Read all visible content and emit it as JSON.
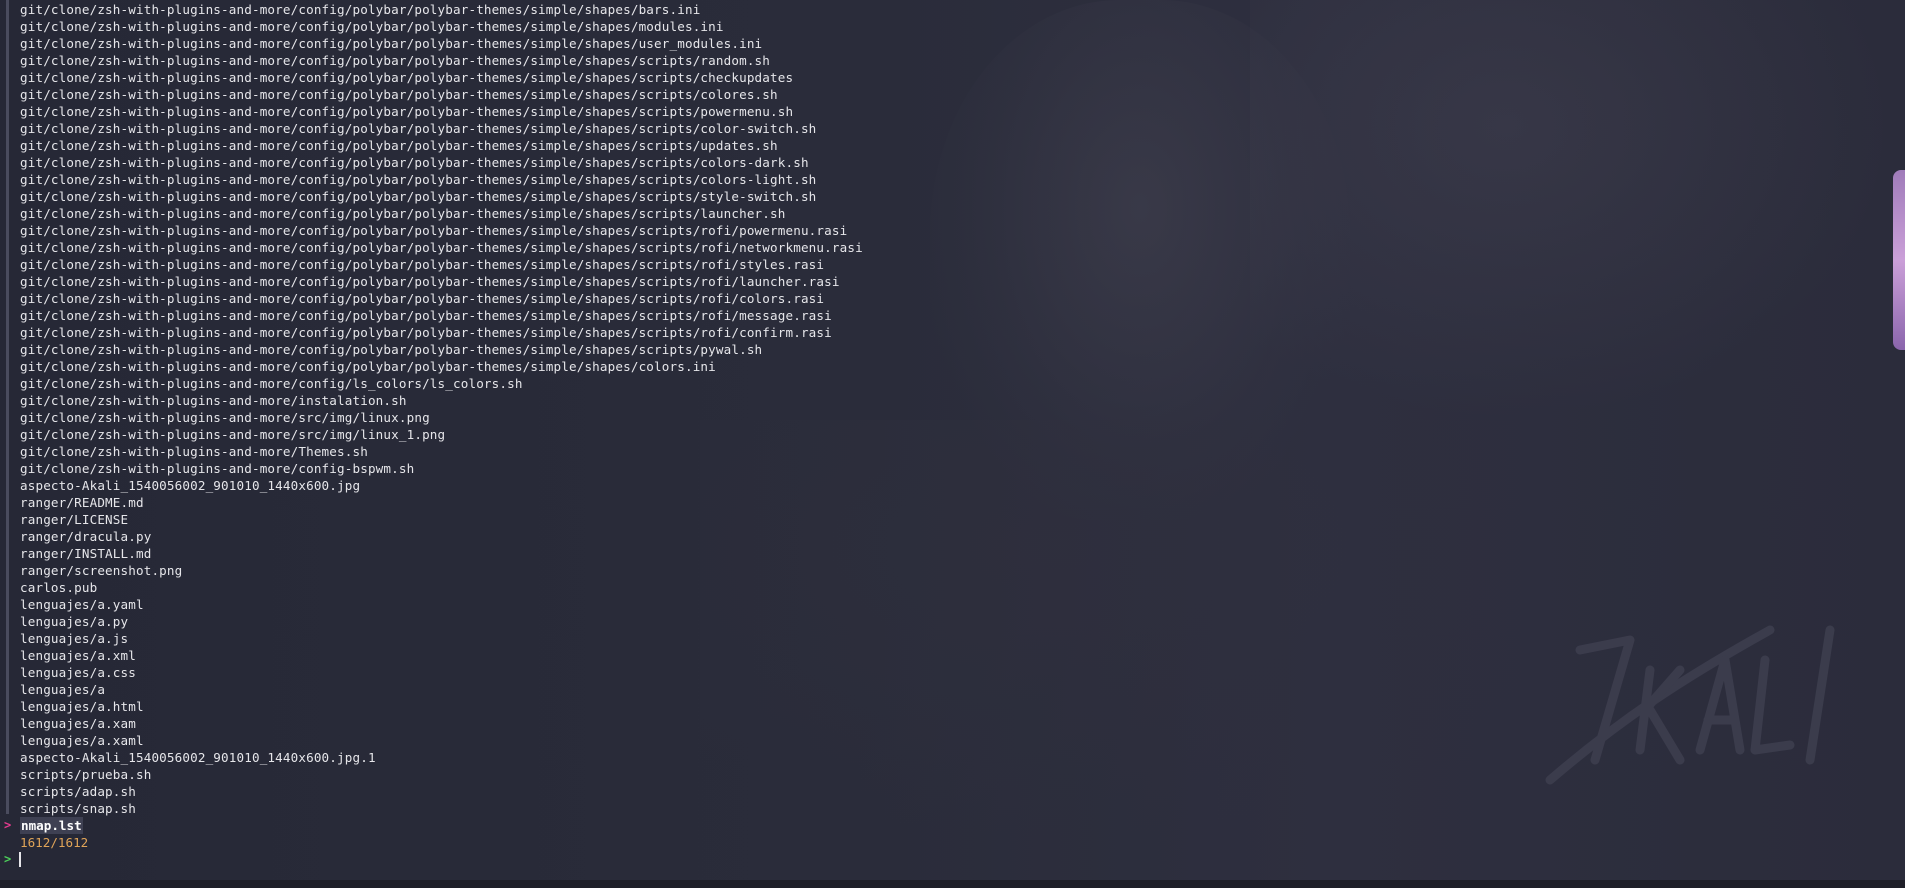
{
  "window": {
    "type": "terminal",
    "tool": "fzf file finder"
  },
  "colors": {
    "background": "#2a2c3a",
    "text": "#e6e6ea",
    "selection_marker": "#e63b8f",
    "prompt_marker": "#4ccf5a",
    "counter": "#e0a458"
  },
  "results": [
    "git/clone/zsh-with-plugins-and-more/config/polybar/polybar-themes/simple/shapes/bars.ini",
    "git/clone/zsh-with-plugins-and-more/config/polybar/polybar-themes/simple/shapes/modules.ini",
    "git/clone/zsh-with-plugins-and-more/config/polybar/polybar-themes/simple/shapes/user_modules.ini",
    "git/clone/zsh-with-plugins-and-more/config/polybar/polybar-themes/simple/shapes/scripts/random.sh",
    "git/clone/zsh-with-plugins-and-more/config/polybar/polybar-themes/simple/shapes/scripts/checkupdates",
    "git/clone/zsh-with-plugins-and-more/config/polybar/polybar-themes/simple/shapes/scripts/colores.sh",
    "git/clone/zsh-with-plugins-and-more/config/polybar/polybar-themes/simple/shapes/scripts/powermenu.sh",
    "git/clone/zsh-with-plugins-and-more/config/polybar/polybar-themes/simple/shapes/scripts/color-switch.sh",
    "git/clone/zsh-with-plugins-and-more/config/polybar/polybar-themes/simple/shapes/scripts/updates.sh",
    "git/clone/zsh-with-plugins-and-more/config/polybar/polybar-themes/simple/shapes/scripts/colors-dark.sh",
    "git/clone/zsh-with-plugins-and-more/config/polybar/polybar-themes/simple/shapes/scripts/colors-light.sh",
    "git/clone/zsh-with-plugins-and-more/config/polybar/polybar-themes/simple/shapes/scripts/style-switch.sh",
    "git/clone/zsh-with-plugins-and-more/config/polybar/polybar-themes/simple/shapes/scripts/launcher.sh",
    "git/clone/zsh-with-plugins-and-more/config/polybar/polybar-themes/simple/shapes/scripts/rofi/powermenu.rasi",
    "git/clone/zsh-with-plugins-and-more/config/polybar/polybar-themes/simple/shapes/scripts/rofi/networkmenu.rasi",
    "git/clone/zsh-with-plugins-and-more/config/polybar/polybar-themes/simple/shapes/scripts/rofi/styles.rasi",
    "git/clone/zsh-with-plugins-and-more/config/polybar/polybar-themes/simple/shapes/scripts/rofi/launcher.rasi",
    "git/clone/zsh-with-plugins-and-more/config/polybar/polybar-themes/simple/shapes/scripts/rofi/colors.rasi",
    "git/clone/zsh-with-plugins-and-more/config/polybar/polybar-themes/simple/shapes/scripts/rofi/message.rasi",
    "git/clone/zsh-with-plugins-and-more/config/polybar/polybar-themes/simple/shapes/scripts/rofi/confirm.rasi",
    "git/clone/zsh-with-plugins-and-more/config/polybar/polybar-themes/simple/shapes/scripts/pywal.sh",
    "git/clone/zsh-with-plugins-and-more/config/polybar/polybar-themes/simple/shapes/colors.ini",
    "git/clone/zsh-with-plugins-and-more/config/ls_colors/ls_colors.sh",
    "git/clone/zsh-with-plugins-and-more/instalation.sh",
    "git/clone/zsh-with-plugins-and-more/src/img/linux.png",
    "git/clone/zsh-with-plugins-and-more/src/img/linux_1.png",
    "git/clone/zsh-with-plugins-and-more/Themes.sh",
    "git/clone/zsh-with-plugins-and-more/config-bspwm.sh",
    "aspecto-Akali_1540056002_901010_1440x600.jpg",
    "ranger/README.md",
    "ranger/LICENSE",
    "ranger/dracula.py",
    "ranger/INSTALL.md",
    "ranger/screenshot.png",
    "carlos.pub",
    "lenguajes/a.yaml",
    "lenguajes/a.py",
    "lenguajes/a.js",
    "lenguajes/a.xml",
    "lenguajes/a.css",
    "lenguajes/a",
    "lenguajes/a.html",
    "lenguajes/a.xam",
    "lenguajes/a.xaml",
    "aspecto-Akali_1540056002_901010_1440x600.jpg.1",
    "scripts/prueba.sh",
    "scripts/adap.sh",
    "scripts/snap.sh"
  ],
  "selected": {
    "marker": ">",
    "value": "nmap.lst"
  },
  "counter": "1612/1612",
  "prompt": {
    "marker": ">",
    "value": ""
  },
  "icons": {
    "selection_marker": "chevron-right-icon",
    "prompt_marker": "prompt-chevron-icon"
  }
}
